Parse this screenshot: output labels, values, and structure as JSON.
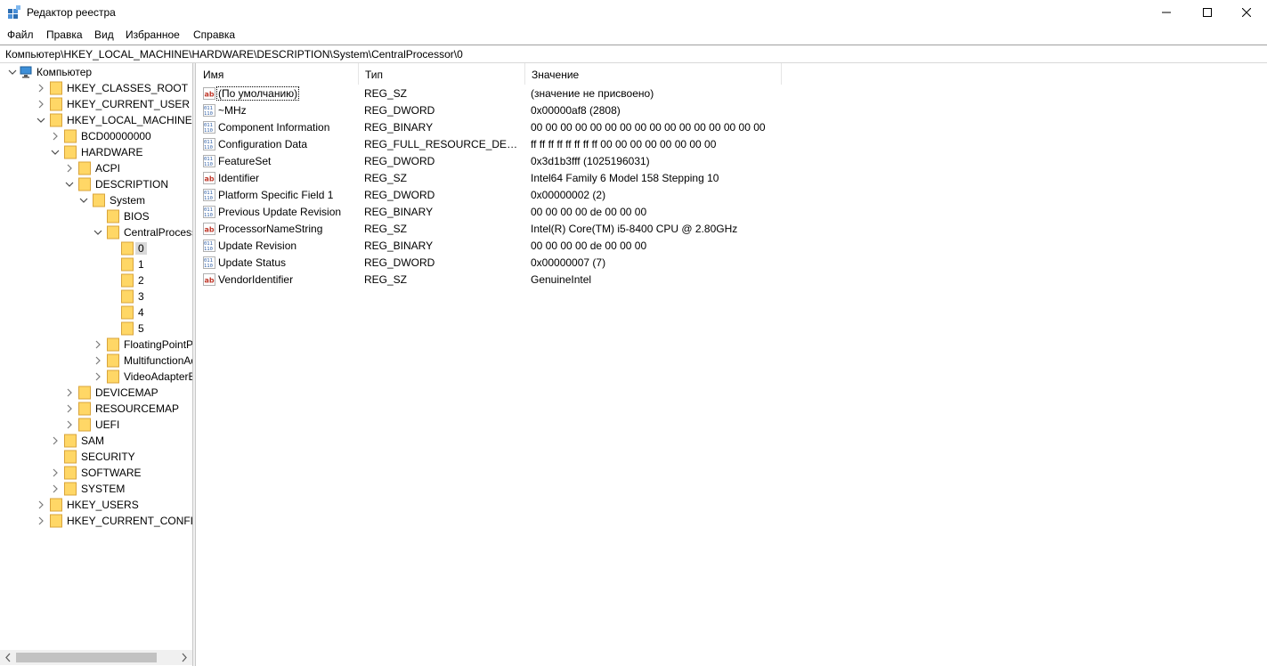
{
  "window": {
    "title": "Редактор реестра",
    "controls": {
      "minimize": "minimize-icon",
      "maximize": "maximize-icon",
      "close": "close-icon"
    }
  },
  "menu": [
    "Файл",
    "Правка",
    "Вид",
    "Избранное",
    "Справка"
  ],
  "address": "Компьютер\\HKEY_LOCAL_MACHINE\\HARDWARE\\DESCRIPTION\\System\\CentralProcessor\\0",
  "tree": [
    {
      "label": "Компьютер",
      "icon": "computer-icon",
      "expanded": true
    },
    {
      "label": "HKEY_CLASSES_ROOT",
      "expanded": false
    },
    {
      "label": "HKEY_CURRENT_USER",
      "expanded": false
    },
    {
      "label": "HKEY_LOCAL_MACHINE",
      "expanded": true
    },
    {
      "label": "BCD00000000",
      "expanded": false
    },
    {
      "label": "HARDWARE",
      "expanded": true
    },
    {
      "label": "ACPI",
      "expanded": false
    },
    {
      "label": "DESCRIPTION",
      "expanded": true
    },
    {
      "label": "System",
      "expanded": true
    },
    {
      "label": "BIOS",
      "expanded": null
    },
    {
      "label": "CentralProcessor",
      "expanded": true
    },
    {
      "label": "0",
      "expanded": null,
      "selected": true
    },
    {
      "label": "1",
      "expanded": null
    },
    {
      "label": "2",
      "expanded": null
    },
    {
      "label": "3",
      "expanded": null
    },
    {
      "label": "4",
      "expanded": null
    },
    {
      "label": "5",
      "expanded": null
    },
    {
      "label": "FloatingPointProc",
      "expanded": false
    },
    {
      "label": "MultifunctionAda",
      "expanded": false
    },
    {
      "label": "VideoAdapterBus",
      "expanded": false
    },
    {
      "label": "DEVICEMAP",
      "expanded": false
    },
    {
      "label": "RESOURCEMAP",
      "expanded": false
    },
    {
      "label": "UEFI",
      "expanded": false
    },
    {
      "label": "SAM",
      "expanded": false
    },
    {
      "label": "SECURITY",
      "expanded": null
    },
    {
      "label": "SOFTWARE",
      "expanded": false
    },
    {
      "label": "SYSTEM",
      "expanded": false
    },
    {
      "label": "HKEY_USERS",
      "expanded": false
    },
    {
      "label": "HKEY_CURRENT_CONFIG",
      "expanded": false
    }
  ],
  "columns": [
    "Имя",
    "Тип",
    "Значение"
  ],
  "values": [
    {
      "icon": "string-value-icon",
      "name": "(По умолчанию)",
      "type": "REG_SZ",
      "data": "(значение не присвоено)"
    },
    {
      "icon": "binary-value-icon",
      "name": "~MHz",
      "type": "REG_DWORD",
      "data": "0x00000af8 (2808)"
    },
    {
      "icon": "binary-value-icon",
      "name": "Component Information",
      "type": "REG_BINARY",
      "data": "00 00 00 00 00 00 00 00 00 00 00 00 00 00 00 00"
    },
    {
      "icon": "binary-value-icon",
      "name": "Configuration Data",
      "type": "REG_FULL_RESOURCE_DESCRIP...",
      "data": "ff ff ff ff ff ff ff ff 00 00 00 00 00 00 00 00"
    },
    {
      "icon": "binary-value-icon",
      "name": "FeatureSet",
      "type": "REG_DWORD",
      "data": "0x3d1b3fff (1025196031)"
    },
    {
      "icon": "string-value-icon",
      "name": "Identifier",
      "type": "REG_SZ",
      "data": "Intel64 Family 6 Model 158 Stepping 10"
    },
    {
      "icon": "binary-value-icon",
      "name": "Platform Specific Field 1",
      "type": "REG_DWORD",
      "data": "0x00000002 (2)"
    },
    {
      "icon": "binary-value-icon",
      "name": "Previous Update Revision",
      "type": "REG_BINARY",
      "data": "00 00 00 00 de 00 00 00"
    },
    {
      "icon": "string-value-icon",
      "name": "ProcessorNameString",
      "type": "REG_SZ",
      "data": "Intel(R) Core(TM) i5-8400 CPU @ 2.80GHz"
    },
    {
      "icon": "binary-value-icon",
      "name": "Update Revision",
      "type": "REG_BINARY",
      "data": "00 00 00 00 de 00 00 00"
    },
    {
      "icon": "binary-value-icon",
      "name": "Update Status",
      "type": "REG_DWORD",
      "data": "0x00000007 (7)"
    },
    {
      "icon": "string-value-icon",
      "name": "VendorIdentifier",
      "type": "REG_SZ",
      "data": "GenuineIntel"
    }
  ],
  "colors": {
    "folder": "#ffd766",
    "folder_edge": "#d9a43b",
    "selection": "#d9d9d9",
    "string_icon": "#c0392b",
    "binary_icon": "#2f5fa7"
  }
}
